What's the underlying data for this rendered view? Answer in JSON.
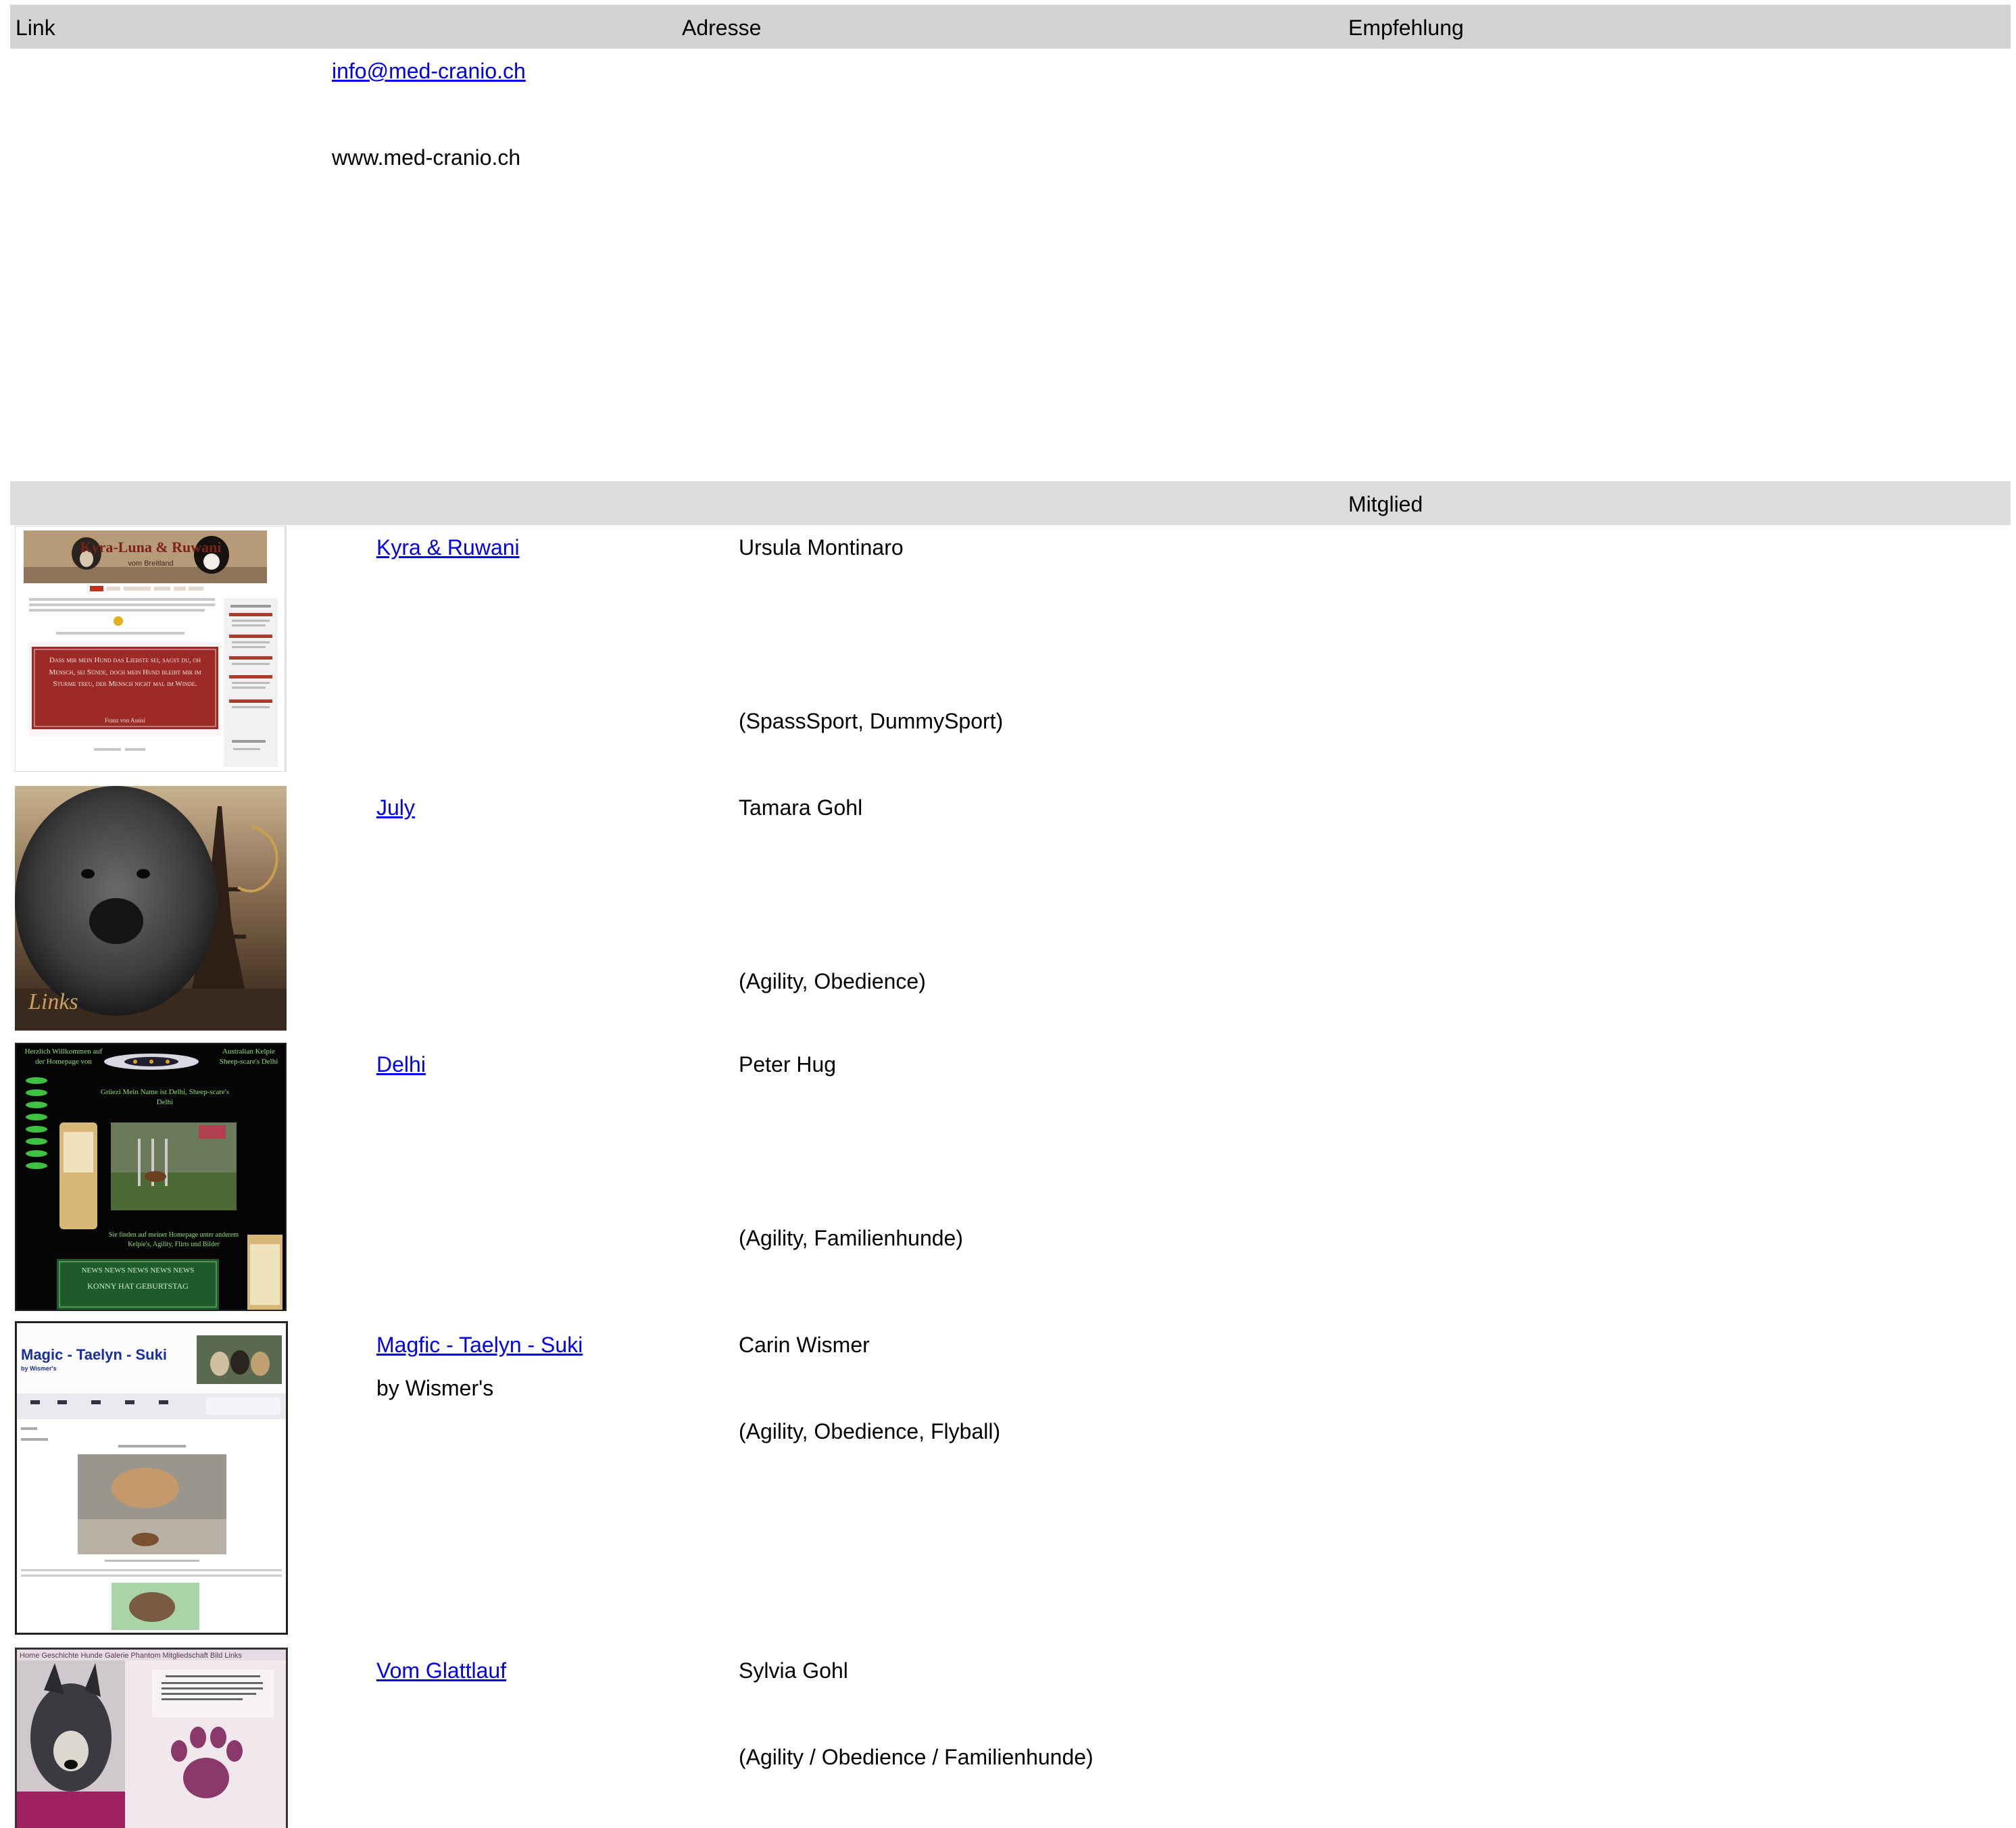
{
  "header": {
    "col_link": "Link",
    "col_adresse": "Adresse",
    "col_empfehlung": "Empfehlung"
  },
  "top_entry": {
    "email": "info@med-cranio.ch",
    "website": "www.med-cranio.ch"
  },
  "section2": {
    "title": "Mitglied"
  },
  "thumbnail_text": {
    "kyra_banner": "Kyra-Luna & Ruwani",
    "kyra_banner_sub": "vom Breitland",
    "kyra_quote": "Dass mir mein Hund das Liebste sei, sagst du, oh Mensch, sei Sünde, doch mein Hund bleibt mir im Sturme treu, der Mensch nicht mal im Winde.",
    "kyra_quote_author": "Franz von Assisi",
    "july_watermark": "Links",
    "delhi_left": "Herzlich Willkommen auf der Homepage von",
    "delhi_right": "Australian Kelpie Sheep-scare's Delhi",
    "delhi_center": "Grüezi Mein Name ist Delhi, Sheep-scare's Delhi",
    "delhi_news": "NEWS NEWS NEWS NEWS NEWS",
    "delhi_birthday": "KONNY HAT GEBURTSTAG",
    "magic_title": "Magic - Taelyn - Suki",
    "magic_sub": "by Wismer's",
    "glatt_nav": "Home Geschichte Hunde Galerie Phantom Mitgliedschaft Bild Links"
  },
  "rows": [
    {
      "link": "Kyra & Ruwani",
      "extra": "",
      "member": "Ursula Montinaro",
      "sports": "(SpassSport, DummySport)"
    },
    {
      "link": "July",
      "extra": "",
      "member": "Tamara Gohl",
      "sports": "(Agility, Obedience)"
    },
    {
      "link": "Delhi",
      "extra": "",
      "member": "Peter Hug",
      "sports": "(Agility, Familienhunde)"
    },
    {
      "link": "Magfic - Taelyn - Suki",
      "extra": "by Wismer's",
      "member": "Carin Wismer",
      "sports": "(Agility, Obedience, Flyball)"
    },
    {
      "link": "Vom Glattlauf",
      "extra": "",
      "member": "Sylvia Gohl",
      "sports": "(Agility / Obedience / Familienhunde)"
    }
  ],
  "colors": {
    "header_bg": "#d3d3d3",
    "section_bg": "#dcdcdc",
    "link": "#0000ee"
  }
}
